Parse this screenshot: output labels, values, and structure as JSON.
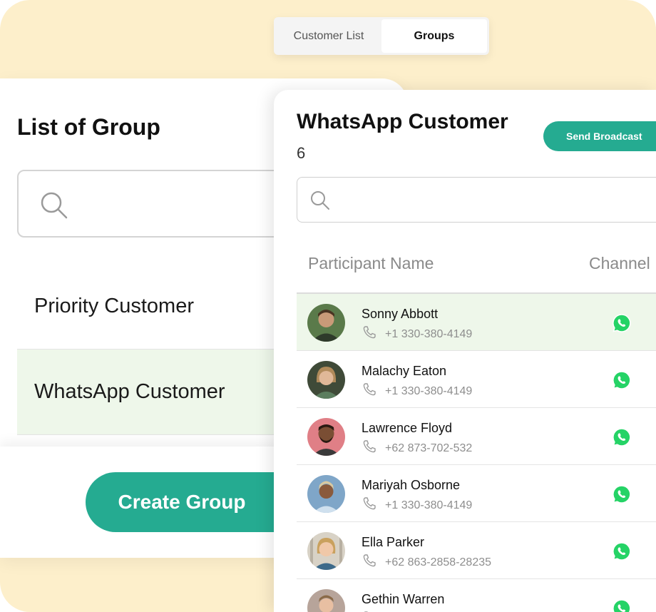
{
  "tabs": [
    {
      "label": "Customer List",
      "active": false
    },
    {
      "label": "Groups",
      "active": true
    }
  ],
  "group_list": {
    "title": "List of Group",
    "search_placeholder": "",
    "groups": [
      {
        "name": "Priority Customer",
        "selected": false
      },
      {
        "name": "WhatsApp Customer",
        "selected": true
      }
    ],
    "create_label": "Create Group"
  },
  "group_detail": {
    "title": "WhatsApp Customer",
    "count": "6",
    "broadcast_label": "Send Broadcast",
    "search_placeholder": "",
    "columns": {
      "name": "Participant Name",
      "channel": "Channel"
    },
    "participants": [
      {
        "name": "Sonny Abbott",
        "phone": "+1 330-380-4149",
        "channel": "whatsapp-icon",
        "selected": true
      },
      {
        "name": "Malachy Eaton",
        "phone": "+1 330-380-4149",
        "channel": "whatsapp-icon",
        "selected": false
      },
      {
        "name": "Lawrence Floyd",
        "phone": "+62 873-702-532",
        "channel": "whatsapp-icon",
        "selected": false
      },
      {
        "name": "Mariyah Osborne",
        "phone": "+1 330-380-4149",
        "channel": "whatsapp-icon",
        "selected": false
      },
      {
        "name": "Ella Parker",
        "phone": "+62 863-2858-28235",
        "channel": "whatsapp-icon",
        "selected": false
      },
      {
        "name": "Gethin Warren",
        "phone": "",
        "channel": "whatsapp-icon",
        "selected": false
      }
    ]
  },
  "colors": {
    "accent": "#25ab91",
    "background": "#fdefcb",
    "selected_row": "#eef7ea",
    "whatsapp": "#25d366"
  }
}
